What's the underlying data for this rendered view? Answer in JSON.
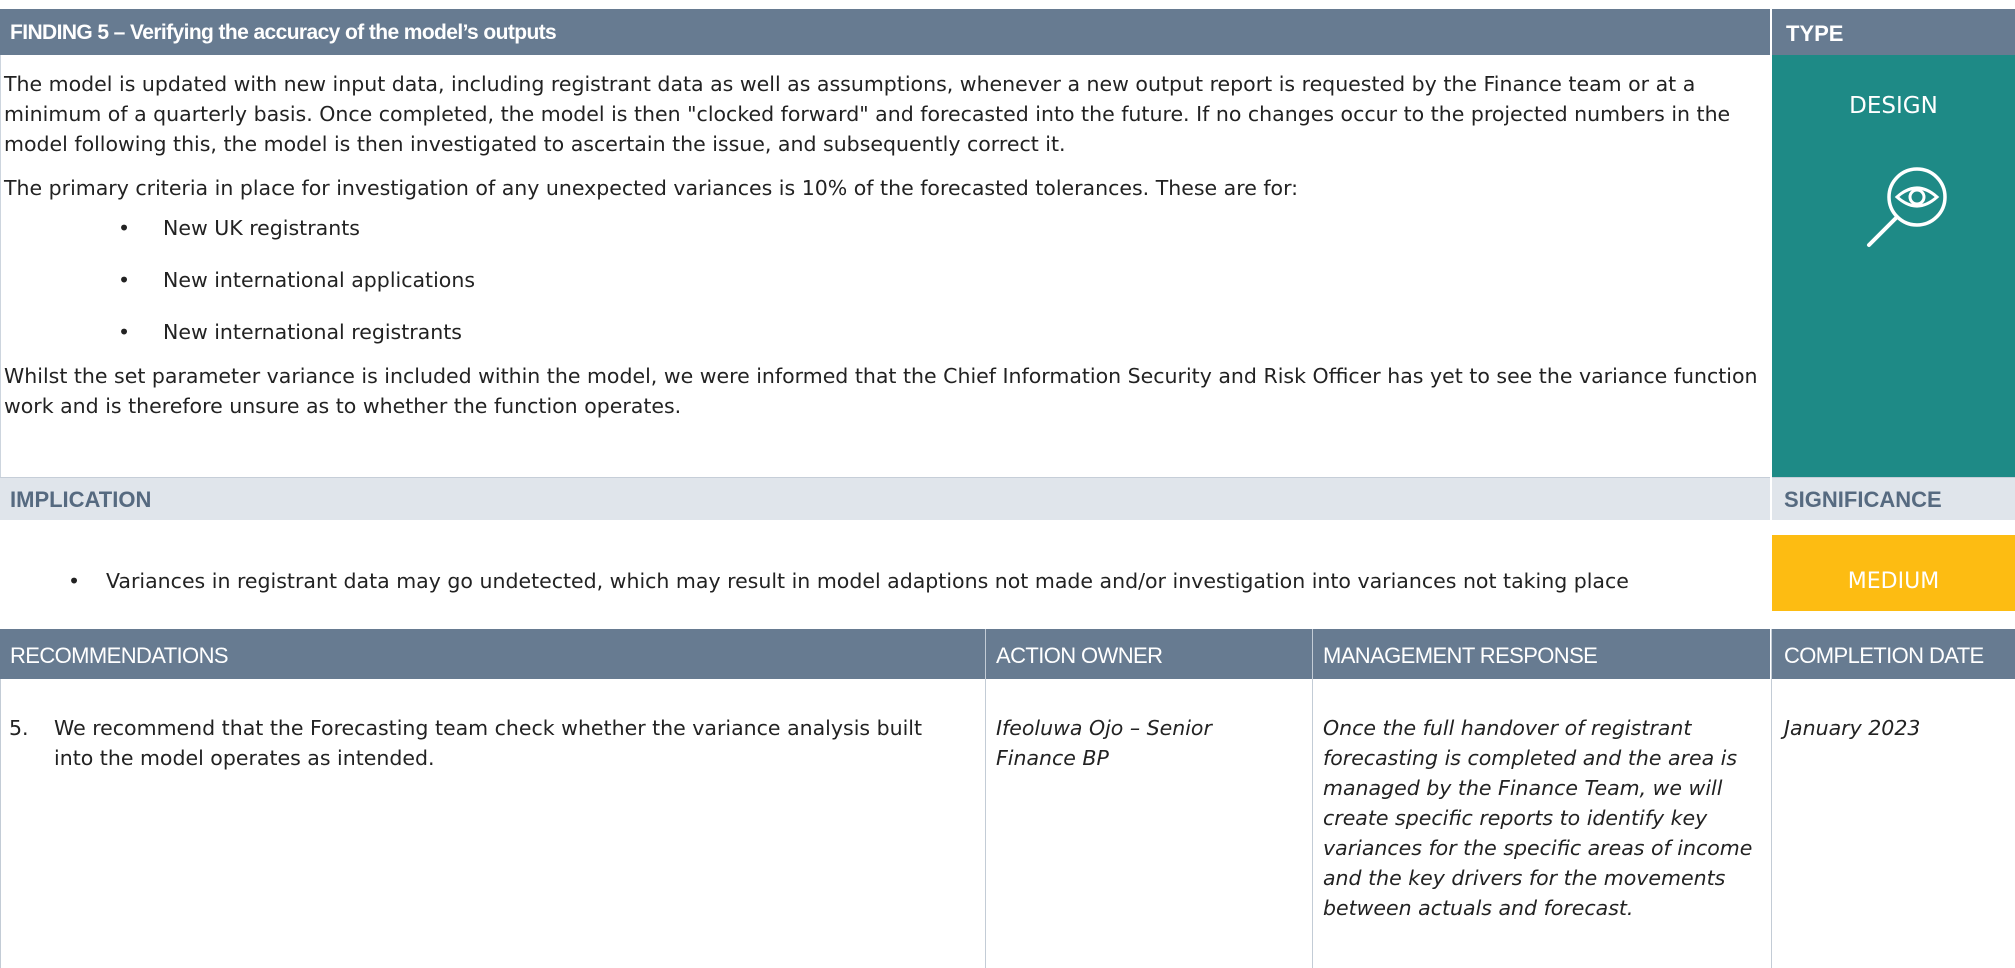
{
  "finding": {
    "header": "FINDING  5 – Verifying the accuracy of the model’s outputs",
    "type_header": "TYPE",
    "para1": "The model is updated with new input data, including registrant data as well as assumptions, whenever a new output report is requested by the Finance team or at a minimum of a quarterly basis. Once completed, the model is then \"clocked forward\" and forecasted into the future. If no changes occur to the projected numbers in the model following this, the model is then investigated to ascertain the issue, and subsequently correct it.",
    "para2": "The primary criteria in place for investigation of any unexpected variances is 10% of the forecasted tolerances. These are for:",
    "bullets": [
      "New UK registrants",
      "New international applications",
      "New international registrants"
    ],
    "para3": "Whilst the set parameter variance is included within the model, we were informed that the Chief Information Security and Risk Officer has yet to see the variance function work and is therefore unsure as to whether the function operates.",
    "type_value": "DESIGN",
    "type_icon": "magnifier-eye-icon"
  },
  "implication": {
    "header": "IMPLICATION",
    "significance_header": "SIGNIFICANCE",
    "text": "Variances in registrant data may go undetected, which may result in model adaptions not made and/or investigation into variances not taking place",
    "significance_value": "MEDIUM",
    "significance_color": "#fdbc12"
  },
  "recommendations": {
    "headers": {
      "recommendations": "RECOMMENDATIONS",
      "action_owner": "ACTION OWNER",
      "management_response": "MANAGEMENT RESPONSE",
      "completion_date": "COMPLETION DATE"
    },
    "number": "5.",
    "text": "We recommend that the Forecasting team check whether the variance analysis built into the model operates as intended.",
    "action_owner": "Ifeoluwa Ojo – Senior Finance BP",
    "management_response": "Once the full handover of registrant forecasting is completed and the area is managed by the Finance Team, we will create specific reports to identify key variances for the specific areas of income and the key drivers for the movements between actuals and forecast.",
    "completion_date": "January 2023"
  },
  "colors": {
    "header_bg": "#677b91",
    "type_bg": "#1e8a86",
    "subheader_bg": "#e0e5eb"
  }
}
